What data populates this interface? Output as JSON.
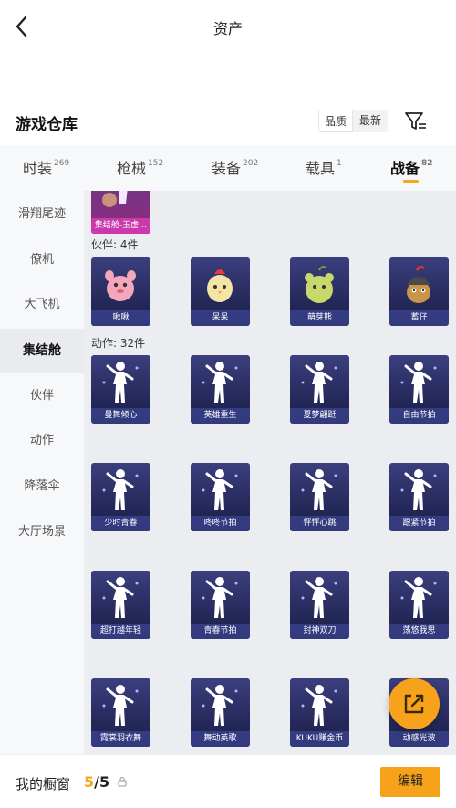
{
  "header": {
    "title": "资产"
  },
  "warehouse": {
    "title": "游戏仓库",
    "sort": [
      "品质",
      "最新"
    ]
  },
  "tabs": [
    {
      "label": "时装",
      "count": "269"
    },
    {
      "label": "枪械",
      "count": "152"
    },
    {
      "label": "装备",
      "count": "202"
    },
    {
      "label": "载具",
      "count": "1"
    },
    {
      "label": "战备",
      "count": "82"
    }
  ],
  "sidebar": [
    "滑翔尾迹",
    "僚机",
    "大飞机",
    "集结舱",
    "伙伴",
    "动作",
    "降落伞",
    "大厅场景"
  ],
  "content": {
    "top_item": "集结舱-玉虚…",
    "partners": {
      "label": "伙伴: 4件",
      "items": [
        "啾啾",
        "呆呆",
        "萌芽熊",
        "蓄仔"
      ]
    },
    "actions": {
      "label": "动作: 32件",
      "items": [
        "曼舞倾心",
        "英雄重生",
        "夏梦翩跹",
        "自由节拍",
        "少时青春",
        "咚咚节拍",
        "怦怦心跳",
        "跟紧节拍",
        "超打越年轻",
        "青春节拍",
        "封神双刀",
        "荡悠我思",
        "霓裳羽衣舞",
        "舞动英歌",
        "KUKU赚金币",
        "动感光波"
      ]
    }
  },
  "footer": {
    "label": "我的橱窗",
    "count_current": "5",
    "count_total": "/5",
    "edit_label": "编辑"
  },
  "colors": {
    "accent": "#f7a21b",
    "card": "#2b2f66"
  },
  "icons": [
    "back-arrow-icon",
    "filter-icon",
    "lock-icon",
    "share-export-icon"
  ]
}
